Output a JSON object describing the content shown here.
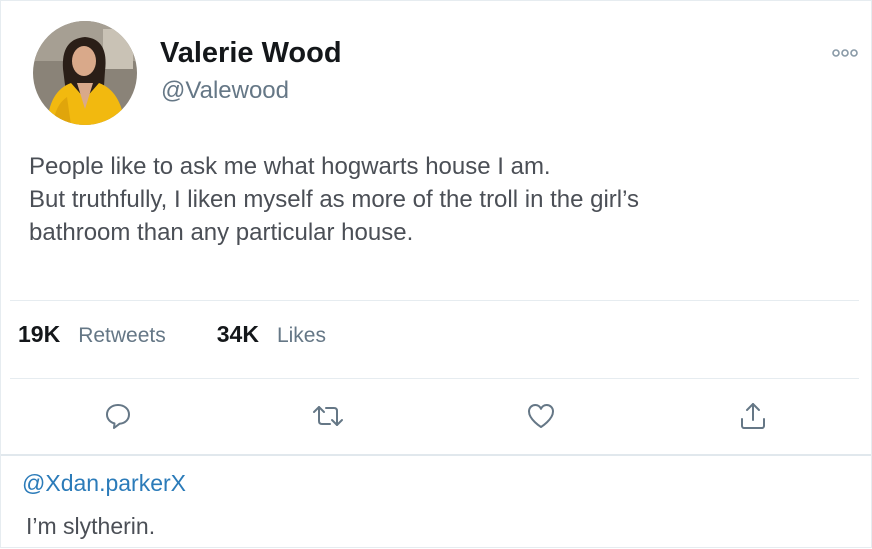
{
  "tweet": {
    "author": {
      "display_name": "Valerie Wood",
      "handle": "@Valewood"
    },
    "text_lines": [
      "People like to ask me what hogwarts house I am.",
      "But truthfully, I liken myself as more of the troll in the girl’s",
      "bathroom than any particular house."
    ],
    "stats": {
      "retweets_count": "19K",
      "retweets_label": "Retweets",
      "likes_count": "34K",
      "likes_label": "Likes"
    },
    "actions": [
      "reply-icon",
      "retweet-icon",
      "like-icon",
      "share-icon"
    ]
  },
  "reply": {
    "handle": "@Xdan.parkerX",
    "text": "I’m slytherin."
  },
  "colors": {
    "accent": "#2b7bb9",
    "text": "#14171a",
    "secondary": "#657786",
    "icon": "#657786",
    "border": "#e6ecf0"
  }
}
